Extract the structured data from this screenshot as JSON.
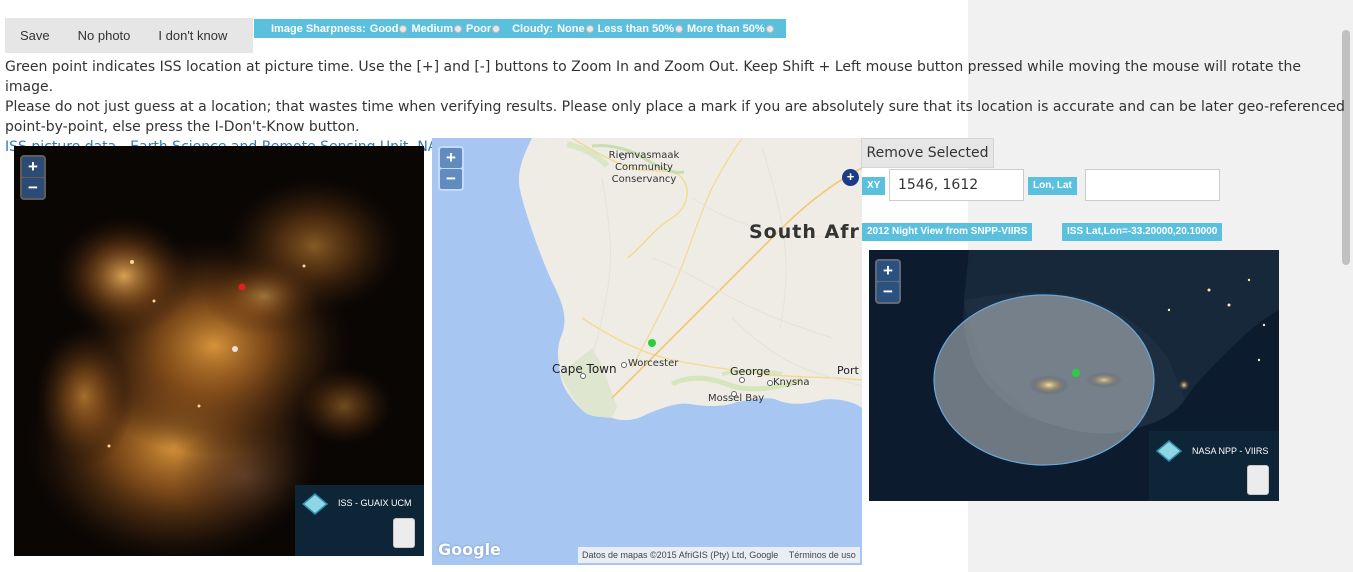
{
  "toolbar": {
    "save": "Save",
    "no_photo": "No photo",
    "dont_know": "I don't know"
  },
  "options": {
    "sharpness_label": "Image Sharpness:",
    "sharpness": [
      "Good",
      "Medium",
      "Poor"
    ],
    "cloudy_label": "Cloudy:",
    "cloudy": [
      "None",
      "Less than 50%",
      "More than 50%"
    ]
  },
  "instructions": {
    "line1": "Green point indicates ISS location at picture time. Use the [+] and [-] buttons to Zoom In and Zoom Out. Keep Shift + Left mouse button pressed while moving the mouse will rotate the image.",
    "line2": "Please do not just guess at a location; that wastes time when verifying results. Please only place a mark if you are absolutely sure that its location is accurate and can be later geo-referenced point-by-point, else press the I-Don't-Know button.",
    "credit": "ISS picture data - Earth Science and Remote Sensing Unit, NASA-Johnson Space Center. \"The Gateway to Astronaut Photography of Earth.\""
  },
  "iss_photo": {
    "zoom_in": "+",
    "zoom_out": "−",
    "layer_name": "ISS - GUAIX UCM"
  },
  "google_map": {
    "zoom_in": "+",
    "zoom_out": "−",
    "labels": {
      "conservancy_1": "Riemvasmaak",
      "conservancy_2": "Community Conservancy",
      "country": "South Afr",
      "cape_town": "Cape Town",
      "worcester": "Worcester",
      "george": "George",
      "knysna": "Knysna",
      "mossel_bay": "Mossel Bay",
      "port": "Port"
    },
    "logo": "Google",
    "attribution": "Datos de mapas ©2015 AfriGIS (Pty) Ltd, Google",
    "terms": "Términos de uso"
  },
  "controls": {
    "remove_selected": "Remove Selected",
    "xy_label": "XY",
    "xy_value": "1546, 1612",
    "lonlat_label": "Lon, Lat",
    "lonlat_value": "",
    "night_view_label": "2012 Night View from SNPP-VIIRS",
    "iss_latlon_label": "ISS Lat,Lon=-33.20000,20.10000"
  },
  "night_map": {
    "zoom_in": "+",
    "zoom_out": "−",
    "layer_name": "NASA NPP - VIIRS"
  },
  "colors": {
    "accent": "#5bc0de",
    "link": "#337ab7",
    "marker_green": "#2ecc40",
    "marker_red": "#e02020"
  }
}
